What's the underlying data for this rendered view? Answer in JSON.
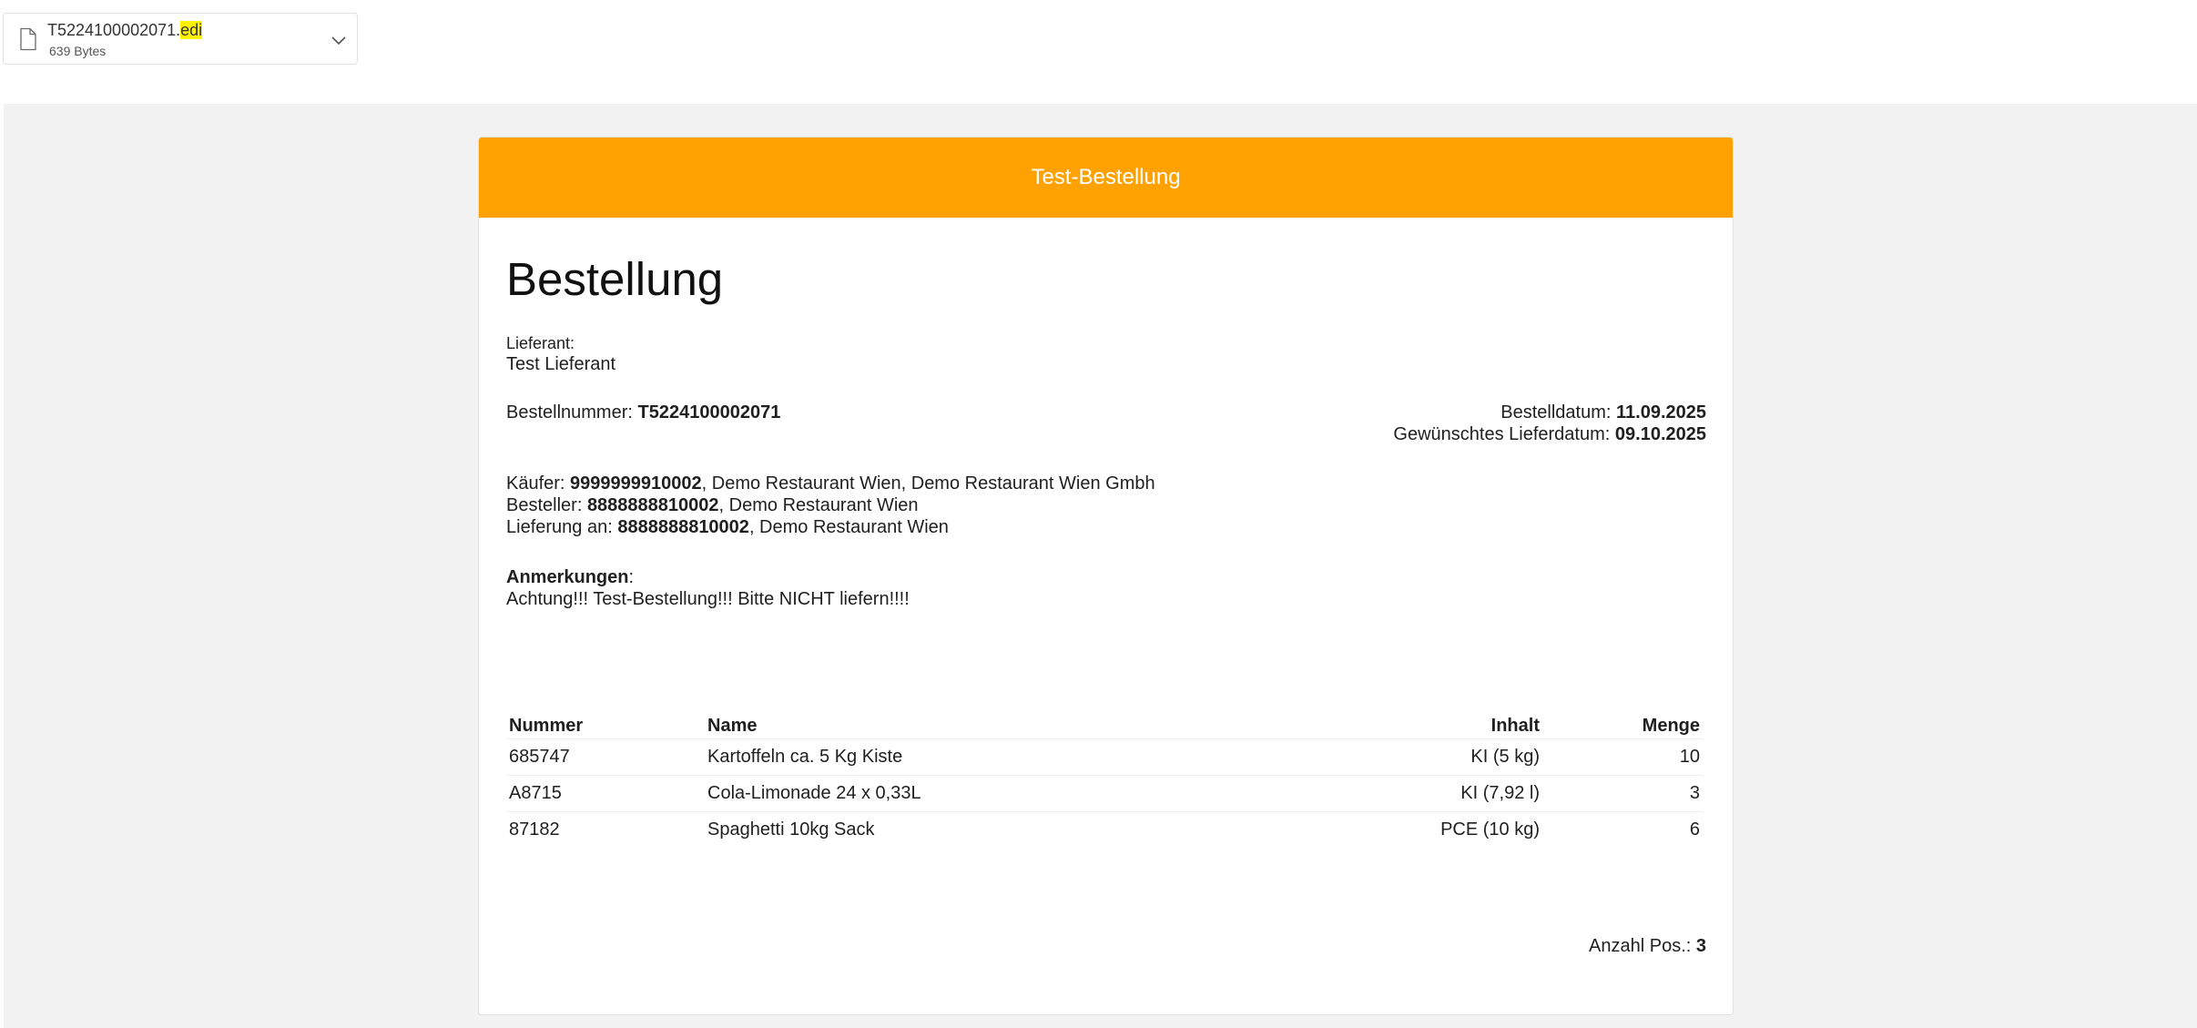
{
  "attachment": {
    "file_base": "T5224100002071.",
    "file_ext": "edi",
    "file_size": "639 Bytes",
    "icon": "file-icon",
    "expand_icon": "chevron-down-icon"
  },
  "banner": {
    "title": "Test-Bestellung",
    "color": "#ffa100"
  },
  "doc": {
    "title": "Bestellung",
    "supplier_label": "Lieferant:",
    "supplier_name": "Test Lieferant",
    "order_number_label": "Bestellnummer: ",
    "order_number": "T5224100002071",
    "order_date_label": "Bestelldatum: ",
    "order_date": "11.09.2025",
    "delivery_date_label": "Gewünschtes Lieferdatum: ",
    "delivery_date": "09.10.2025",
    "buyer_label": "Käufer: ",
    "buyer_id": "9999999910002",
    "buyer_rest": ", Demo Restaurant Wien, Demo Restaurant Wien Gmbh",
    "orderer_label": "Besteller: ",
    "orderer_id": "8888888810002",
    "orderer_rest": ", Demo Restaurant Wien",
    "delivery_to_label": "Lieferung an: ",
    "delivery_to_id": "8888888810002",
    "delivery_to_rest": ", Demo Restaurant Wien",
    "remarks_label": "Anmerkungen",
    "remarks_colon": ":",
    "remarks_text": "Achtung!!! Test-Bestellung!!! Bitte NICHT liefern!!!!"
  },
  "table": {
    "headers": {
      "number": "Nummer",
      "name": "Name",
      "content": "Inhalt",
      "quantity": "Menge"
    },
    "rows": [
      {
        "number": "685747",
        "name": "Kartoffeln ca. 5 Kg Kiste",
        "content": "KI (5 kg)",
        "quantity": "10"
      },
      {
        "number": "A8715",
        "name": "Cola-Limonade 24 x 0,33L",
        "content": "KI (7,92 l)",
        "quantity": "3"
      },
      {
        "number": "87182",
        "name": "Spaghetti 10kg Sack",
        "content": "PCE (10 kg)",
        "quantity": "6"
      }
    ]
  },
  "footer": {
    "count_label": "Anzahl Pos.: ",
    "count_value": "3"
  }
}
